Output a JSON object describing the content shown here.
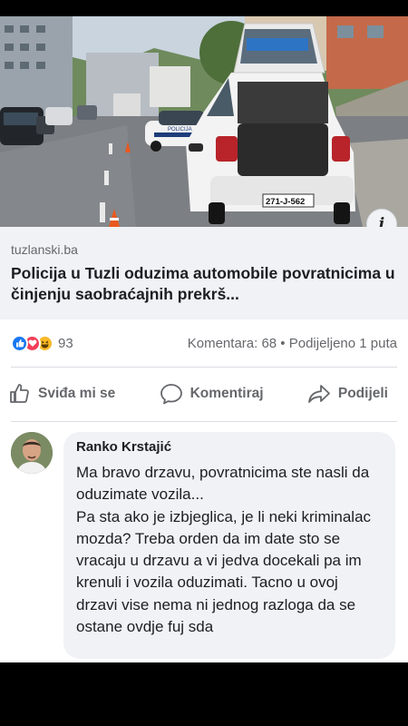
{
  "link_preview": {
    "plate_text": "271-J-562",
    "car_text": "POLICIJA",
    "info_icon": "i",
    "domain": "tuzlanski.ba",
    "headline": "Policija u Tuzli oduzima automobile povratnicima u činjenju saobraćajnih prekrš..."
  },
  "stats": {
    "reaction_icons": [
      "like-icon",
      "love-icon",
      "haha-icon"
    ],
    "reaction_count": "93",
    "comments_shares": "Komentara: 68 • Podijeljeno 1 puta"
  },
  "actions": {
    "like": "Sviđa mi se",
    "comment": "Komentiraj",
    "share": "Podijeli"
  },
  "comment": {
    "author": "Ranko Krstajić",
    "text": "Ma bravo drzavu, povratnicima ste nasli da oduzimate vozila...\nPa sta ako je izbjeglica, je li neki kriminalac mozda? Treba orden da im date sto se vracaju u drzavu a vi jedva docekali pa im krenuli i vozila oduzimati. Tacno u ovoj drzavi vise nema ni jednog razloga da se ostane ovdje fuj sda"
  },
  "colors": {
    "accent_like": "#1877f2",
    "love": "#f33e58",
    "haha": "#f7b928",
    "secondary_text": "#65676b"
  }
}
